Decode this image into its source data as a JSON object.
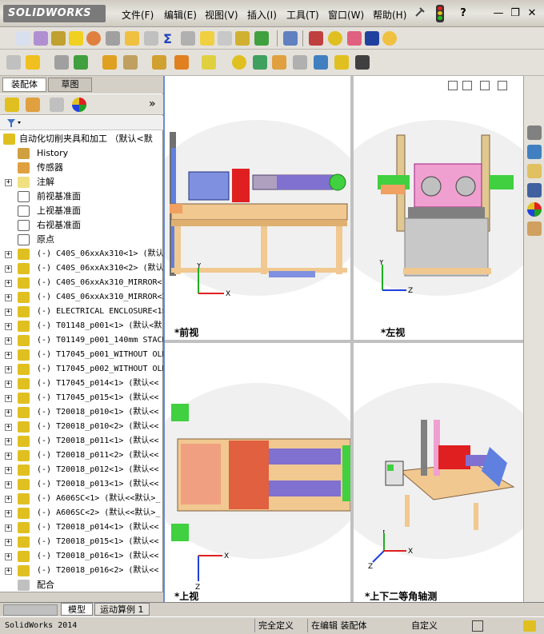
{
  "app": {
    "logo": "SOLIDWORKS"
  },
  "menu": [
    "文件(F)",
    "编辑(E)",
    "视图(V)",
    "插入(I)",
    "工具(T)",
    "窗口(W)",
    "帮助(H)"
  ],
  "window_controls": {
    "help": "?",
    "min": "—",
    "restore": "❐",
    "close": "✕"
  },
  "panel": {
    "tabs": [
      "装配体",
      "草图"
    ],
    "collapse": "»",
    "root_label": "自动化切削夹具和加工 （默认<默",
    "items": [
      {
        "label": "History",
        "icon": "history-icon",
        "expand": false
      },
      {
        "label": "传感器",
        "icon": "sensor-icon",
        "expand": false
      },
      {
        "label": "注解",
        "icon": "annotation-icon",
        "expand": true
      },
      {
        "label": "前视基准面",
        "icon": "plane-icon",
        "expand": false
      },
      {
        "label": "上视基准面",
        "icon": "plane-icon",
        "expand": false
      },
      {
        "label": "右视基准面",
        "icon": "plane-icon",
        "expand": false
      },
      {
        "label": "原点",
        "icon": "origin-icon",
        "expand": false
      },
      {
        "label": "(-) C40S_06xxAx310<1> (默认/",
        "icon": "part-icon",
        "expand": true
      },
      {
        "label": "(-) C40S_06xxAx310<2> (默认/",
        "icon": "part-icon",
        "expand": true
      },
      {
        "label": "(-) C40S_06xxAx310_MIRROR<1",
        "icon": "part-icon",
        "expand": true
      },
      {
        "label": "(-) C40S_06xxAx310_MIRROR<2",
        "icon": "part-icon",
        "expand": true
      },
      {
        "label": "(-) ELECTRICAL ENCLOSURE<1>",
        "icon": "part-icon",
        "expand": true
      },
      {
        "label": "(-) T01148_p001<1> (默认<默",
        "icon": "part-icon",
        "expand": true
      },
      {
        "label": "(-) T01149_p001_140mm STACK",
        "icon": "part-icon",
        "expand": true
      },
      {
        "label": "(-) T17045_p001_WITHOUT OLD",
        "icon": "part-icon",
        "expand": true
      },
      {
        "label": "(-) T17045_p002_WITHOUT OLD",
        "icon": "part-icon",
        "expand": true
      },
      {
        "label": "(-) T17045_p014<1> (默认<<",
        "icon": "part-icon",
        "expand": true
      },
      {
        "label": "(-) T17045_p015<1> (默认<<",
        "icon": "part-icon",
        "expand": true
      },
      {
        "label": "(-) T20018_p010<1> (默认<<",
        "icon": "part-icon",
        "expand": true
      },
      {
        "label": "(-) T20018_p010<2> (默认<<",
        "icon": "part-icon",
        "expand": true
      },
      {
        "label": "(-) T20018_p011<1> (默认<<",
        "icon": "part-icon",
        "expand": true
      },
      {
        "label": "(-) T20018_p011<2> (默认<<",
        "icon": "part-icon",
        "expand": true
      },
      {
        "label": "(-) T20018_p012<1> (默认<<",
        "icon": "part-icon",
        "expand": true
      },
      {
        "label": "(-) T20018_p013<1> (默认<<",
        "icon": "part-icon",
        "expand": true
      },
      {
        "label": "(-) A606SC<1> (默认<<默认>_",
        "icon": "part-icon",
        "expand": true
      },
      {
        "label": "(-) A606SC<2> (默认<<默认>_",
        "icon": "part-icon",
        "expand": true
      },
      {
        "label": "(-) T20018_p014<1> (默认<<",
        "icon": "part-icon",
        "expand": true
      },
      {
        "label": "(-) T20018_p015<1> (默认<<",
        "icon": "part-icon",
        "expand": true
      },
      {
        "label": "(-) T20018_p016<1> (默认<<",
        "icon": "part-icon",
        "expand": true
      },
      {
        "label": "(-) T20018_p016<2> (默认<<",
        "icon": "part-icon",
        "expand": true
      },
      {
        "label": "配合",
        "icon": "mates-icon",
        "expand": false
      }
    ]
  },
  "viewports": {
    "front": "*前视",
    "left": "*左视",
    "top": "*上视",
    "iso": "*上下二等角轴测"
  },
  "bottom_tabs": [
    "模型",
    "运动算例 1"
  ],
  "status": {
    "app": "SolidWorks 2014",
    "defined": "完全定义",
    "editing": "在编辑 装配体",
    "custom": "自定义"
  },
  "colors": {
    "magenta": "#e060c0",
    "green": "#40d040",
    "orange": "#f0a060",
    "frame": "#f0c890",
    "blue": "#4060c0",
    "purple": "#8060d0"
  }
}
